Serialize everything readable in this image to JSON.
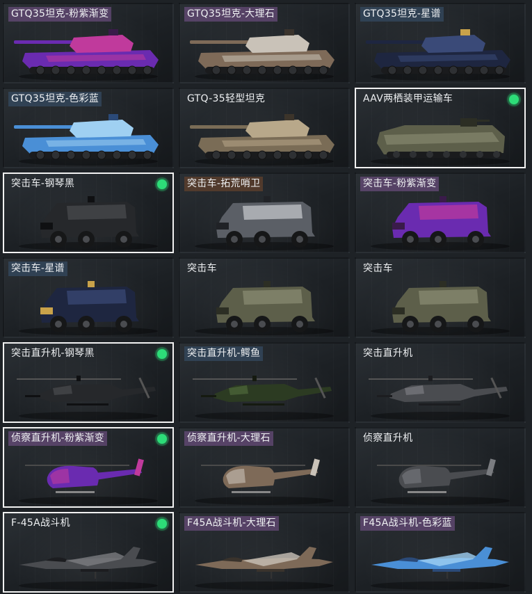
{
  "cards": [
    {
      "label": "GTQ35坦克-粉紫渐变",
      "tag": "purple",
      "kind": "tank",
      "skin": "pinkpurple",
      "equipped": false
    },
    {
      "label": "GTQ35坦克-大理石",
      "tag": "purple",
      "kind": "tank",
      "skin": "marble",
      "equipped": false
    },
    {
      "label": "GTQ35坦克-星谱",
      "tag": "blue",
      "kind": "tank",
      "skin": "star",
      "equipped": false
    },
    {
      "label": "GTQ35坦克-色彩蓝",
      "tag": "blue",
      "kind": "tank",
      "skin": "colorblue",
      "equipped": false
    },
    {
      "label": "GTQ-35轻型坦克",
      "tag": "none",
      "kind": "tank",
      "skin": "desert",
      "equipped": false
    },
    {
      "label": "AAV两栖装甲运输车",
      "tag": "none",
      "kind": "aav",
      "skin": "olive",
      "equipped": true
    },
    {
      "label": "突击车-钢琴黑",
      "tag": "none",
      "kind": "truck",
      "skin": "black",
      "equipped": true
    },
    {
      "label": "突击车-拓荒哨卫",
      "tag": "brown",
      "kind": "truck",
      "skin": "silver",
      "equipped": false
    },
    {
      "label": "突击车-粉紫渐变",
      "tag": "purple",
      "kind": "truck",
      "skin": "pinkpurple",
      "equipped": false
    },
    {
      "label": "突击车-星谱",
      "tag": "blue",
      "kind": "truck",
      "skin": "star",
      "equipped": false
    },
    {
      "label": "突击车",
      "tag": "none",
      "kind": "truck",
      "skin": "olive",
      "equipped": false
    },
    {
      "label": "突击车",
      "tag": "none",
      "kind": "truck",
      "skin": "olive",
      "equipped": false
    },
    {
      "label": "突击直升机-钢琴黑",
      "tag": "none",
      "kind": "apache",
      "skin": "black",
      "equipped": true
    },
    {
      "label": "突击直升机-鳄鱼",
      "tag": "blue",
      "kind": "apache",
      "skin": "croc",
      "equipped": false
    },
    {
      "label": "突击直升机",
      "tag": "none",
      "kind": "apache",
      "skin": "gray",
      "equipped": false
    },
    {
      "label": "侦察直升机-粉紫渐变",
      "tag": "purple",
      "kind": "scout",
      "skin": "pinkpurple",
      "equipped": true
    },
    {
      "label": "侦察直升机-大理石",
      "tag": "purple",
      "kind": "scout",
      "skin": "marble",
      "equipped": false
    },
    {
      "label": "侦察直升机",
      "tag": "none",
      "kind": "scout",
      "skin": "gray",
      "equipped": false
    },
    {
      "label": "F-45A战斗机",
      "tag": "none",
      "kind": "jet",
      "skin": "gray",
      "equipped": true
    },
    {
      "label": "F45A战斗机-大理石",
      "tag": "purple",
      "kind": "jet",
      "skin": "marble",
      "equipped": false
    },
    {
      "label": "F45A战斗机-色彩蓝",
      "tag": "purple",
      "kind": "jet",
      "skin": "colorblue",
      "equipped": false
    }
  ],
  "skins": {
    "pinkpurple": {
      "a": "#c03a9c",
      "b": "#6a2bb0",
      "c": "#3a1b4a"
    },
    "marble": {
      "a": "#c9c2b8",
      "b": "#7e6a58",
      "c": "#3a332c"
    },
    "star": {
      "a": "#3a4a78",
      "b": "#1e2640",
      "c": "#c9a24a"
    },
    "colorblue": {
      "a": "#9fd0f2",
      "b": "#4a8fd6",
      "c": "#2b4a78"
    },
    "desert": {
      "a": "#b8a88a",
      "b": "#7a6c56",
      "c": "#3c342a"
    },
    "olive": {
      "a": "#8c8d74",
      "b": "#5d5f4a",
      "c": "#2c2e24"
    },
    "black": {
      "a": "#4a4c50",
      "b": "#26282b",
      "c": "#0f1012"
    },
    "silver": {
      "a": "#c9ccd0",
      "b": "#5b5f66",
      "c": "#202226"
    },
    "croc": {
      "a": "#4f6a3a",
      "b": "#2c3b22",
      "c": "#151a10"
    },
    "gray": {
      "a": "#7a7c80",
      "b": "#4a4c50",
      "c": "#1c1d20"
    }
  }
}
